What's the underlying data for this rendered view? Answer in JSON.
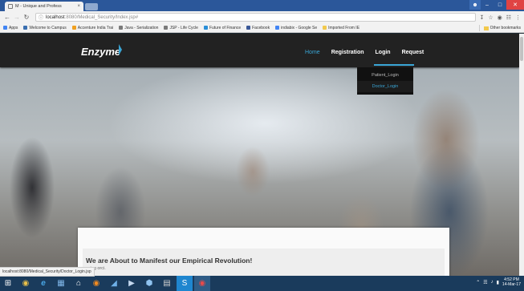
{
  "browser": {
    "tab_title": "M - Unique and Profess",
    "tab_close": "×",
    "url_host": "localhost",
    "url_path": ":8080/Medical_Security/Index.jsp#",
    "bookmarks": [
      {
        "label": "Apps",
        "color": "#4285f4"
      },
      {
        "label": "Welcome to Campus",
        "color": "#3a6fb0"
      },
      {
        "label": "Accenture India Trai",
        "color": "#f0a020"
      },
      {
        "label": "Java - Serialization",
        "color": "#7a7a7a"
      },
      {
        "label": "JSP - Life Cycle",
        "color": "#7a7a7a"
      },
      {
        "label": "Future of Finance",
        "color": "#2a8fd8"
      },
      {
        "label": "Facebook",
        "color": "#3b5998"
      },
      {
        "label": "indiabix - Google Se",
        "color": "#4285f4"
      },
      {
        "label": "Imported From IE",
        "color": "#f2c94c"
      }
    ],
    "other_bookmarks": "Other bookmarks"
  },
  "site": {
    "brand": "Enzyme",
    "nav": [
      {
        "label": "Home",
        "active": true
      },
      {
        "label": "Registration",
        "active": false
      },
      {
        "label": "Login",
        "active": false
      },
      {
        "label": "Request",
        "active": false
      }
    ],
    "dropdown": [
      "Patient_Login",
      "Doctor_Login"
    ],
    "card_title": "We are About to Manifest our Empirical Revolution!",
    "card_subtitle": "scing orci."
  },
  "status_url": "localhost:8080/Medical_Security/Doctor_Login.jsp",
  "taskbar": {
    "time": "4:52 PM",
    "date": "14-Mar-17"
  },
  "colors": {
    "accent": "#3aa6d6",
    "nav_bg": "#222222",
    "taskbar_bg": "#1a3b5c",
    "chrome_bg": "#2b579a"
  }
}
